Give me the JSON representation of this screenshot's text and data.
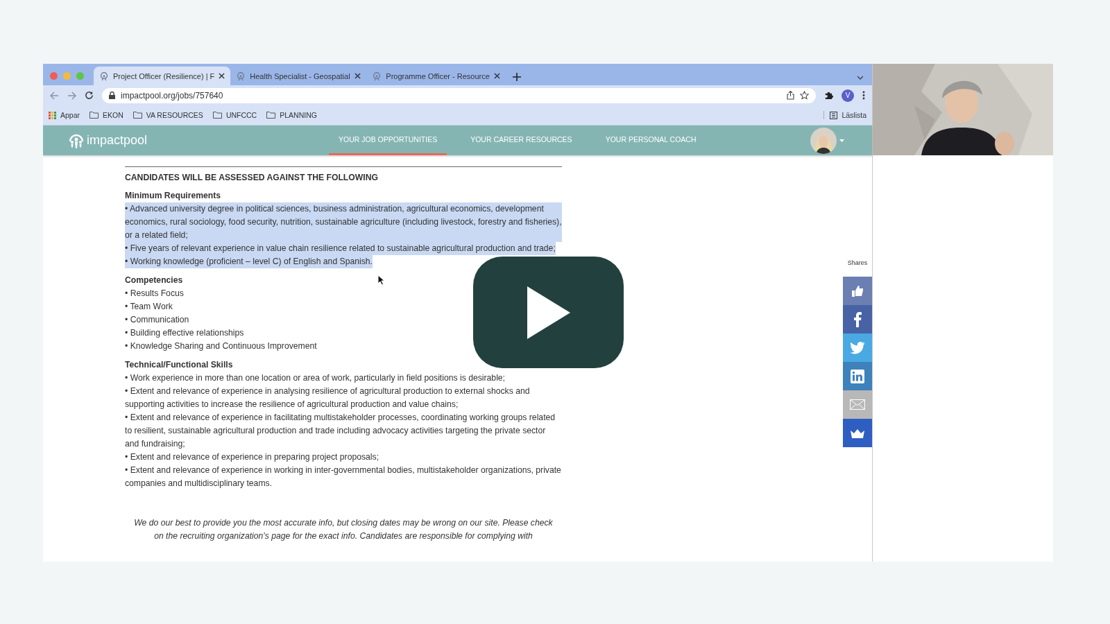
{
  "browser": {
    "tabs": [
      {
        "title": "Project Officer (Resilience) | F",
        "selected": true
      },
      {
        "title": "Health Specialist - Geospatial",
        "selected": false
      },
      {
        "title": "Programme Officer - Resource",
        "selected": false
      }
    ],
    "url": "impactpool.org/jobs/757640",
    "profile_initial": "V",
    "bookmarks": [
      {
        "label": "Appar",
        "kind": "apps"
      },
      {
        "label": "EKON",
        "kind": "folder"
      },
      {
        "label": "VA RESOURCES",
        "kind": "folder"
      },
      {
        "label": "UNFCCC",
        "kind": "folder"
      },
      {
        "label": "PLANNING",
        "kind": "folder"
      }
    ],
    "reading_list": "Läslista"
  },
  "site": {
    "logo": "impactpool",
    "nav": [
      {
        "label": "YOUR JOB OPPORTUNITIES",
        "selected": true
      },
      {
        "label": "YOUR CAREER RESOURCES",
        "selected": false
      },
      {
        "label": "YOUR PERSONAL COACH",
        "selected": false
      }
    ]
  },
  "document": {
    "heading": "CANDIDATES WILL BE ASSESSED AGAINST THE FOLLOWING",
    "sections": [
      {
        "title": "Minimum Requirements",
        "items": [
          {
            "text": "• Advanced university degree in political sciences, business administration, agricultural economics, development economics, rural sociology, food security, nutrition, sustainable agriculture (including livestock, forestry and fisheries), or a related field;",
            "selected": true
          },
          {
            "text": "• Five years of relevant experience in value chain resilience related to sustainable agricultural production and trade;",
            "selected": true
          },
          {
            "text": "• Working knowledge (proficient – level C) of English and Spanish.",
            "selected": true
          }
        ]
      },
      {
        "title": "Competencies",
        "items": [
          {
            "text": "• Results Focus",
            "selected": false
          },
          {
            "text": "• Team Work",
            "selected": false
          },
          {
            "text": "• Communication",
            "selected": false
          },
          {
            "text": "• Building effective relationships",
            "selected": false
          },
          {
            "text": "• Knowledge Sharing and Continuous Improvement",
            "selected": false
          }
        ]
      },
      {
        "title": "Technical/Functional Skills",
        "items": [
          {
            "text": "• Work experience in more than one location or area of work, particularly in field positions is desirable;",
            "selected": false
          },
          {
            "text": "• Extent and relevance of experience in analysing resilience of agricultural production to external shocks and supporting activities to increase the resilience of agricultural production and value chains;",
            "selected": false
          },
          {
            "text": "• Extent and relevance of experience in facilitating multistakeholder processes, coordinating working groups related to resilient, sustainable agricultural production and trade including advocacy activities targeting the private sector and fundraising;",
            "selected": false
          },
          {
            "text": "• Extent and relevance of experience in preparing project proposals;",
            "selected": false
          },
          {
            "text": "• Extent and relevance of experience in working in inter-governmental bodies, multistakeholder organizations, private companies and multidisciplinary teams.",
            "selected": false
          }
        ]
      }
    ],
    "disclaimer": "We do our best to provide you the most accurate info, but closing dates may be wrong on our site. Please check on the recruiting organization's page for the exact info. Candidates are responsible for complying with"
  },
  "shares": {
    "label": "Shares",
    "buttons": [
      {
        "kind": "like",
        "color": "#6b7fb2"
      },
      {
        "kind": "facebook",
        "color": "#4862a6"
      },
      {
        "kind": "twitter",
        "color": "#4aa9e2"
      },
      {
        "kind": "linkedin",
        "color": "#3d82bb"
      },
      {
        "kind": "email",
        "color": "#b8b8b8"
      },
      {
        "kind": "crown",
        "color": "#2f5ec2"
      }
    ]
  }
}
